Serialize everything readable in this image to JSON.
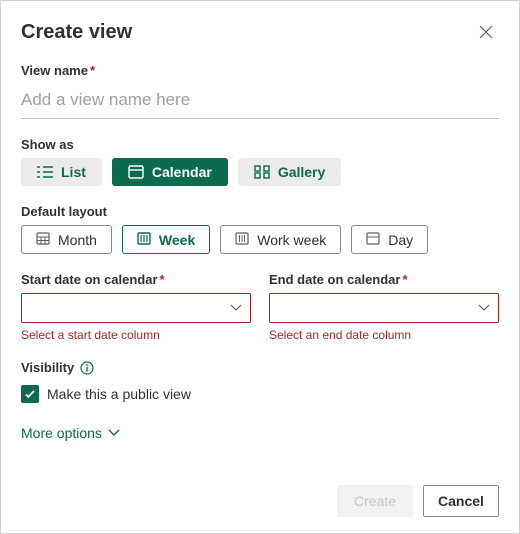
{
  "dialog": {
    "title": "Create view",
    "viewNameLabel": "View name",
    "viewNamePlaceholder": "Add a view name here",
    "viewNameValue": "",
    "showAsLabel": "Show as",
    "showAs": {
      "list": "List",
      "calendar": "Calendar",
      "gallery": "Gallery"
    },
    "defaultLayoutLabel": "Default layout",
    "layout": {
      "month": "Month",
      "week": "Week",
      "workweek": "Work week",
      "day": "Day"
    },
    "startDate": {
      "label": "Start date on calendar",
      "error": "Select a start date column"
    },
    "endDate": {
      "label": "End date on calendar",
      "error": "Select an end date column"
    },
    "visibilityLabel": "Visibility",
    "publicViewLabel": "Make this a public view",
    "moreOptions": "More options",
    "createBtn": "Create",
    "cancelBtn": "Cancel"
  }
}
